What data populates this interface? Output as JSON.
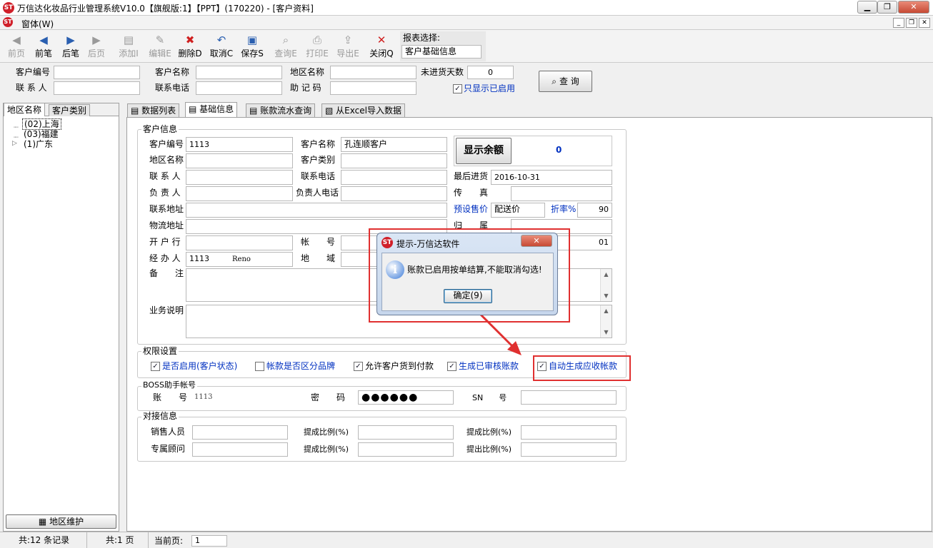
{
  "window": {
    "title": "万信达化妆品行业管理系统V10.0【旗舰版:1】【PPT】(170220) - [客户资料]",
    "logo_text": "ST"
  },
  "menu": {
    "label": "窗体(W)"
  },
  "toolbar": {
    "buttons": [
      {
        "label": "前页",
        "icon": "◀"
      },
      {
        "label": "前笔",
        "icon": "◀"
      },
      {
        "label": "后笔",
        "icon": "▶"
      },
      {
        "label": "后页",
        "icon": "▶"
      },
      {
        "label": "添加I",
        "icon": "▤"
      },
      {
        "label": "编辑E",
        "icon": "✎"
      },
      {
        "label": "删除D",
        "icon": "✖"
      },
      {
        "label": "取消C",
        "icon": "↶"
      },
      {
        "label": "保存S",
        "icon": "▣"
      },
      {
        "label": "查询E",
        "icon": "⌕"
      },
      {
        "label": "打印E",
        "icon": "⎙"
      },
      {
        "label": "导出E",
        "icon": "⇪"
      },
      {
        "label": "关闭Q",
        "icon": "✕"
      }
    ],
    "report_label": "报表选择:",
    "report_value": "客户基础信息"
  },
  "search": {
    "customer_no_label": "客户编号",
    "customer_name_label": "客户名称",
    "region_label": "地区名称",
    "no_ship_days_label": "未进货天数",
    "no_ship_days_value": "0",
    "contact_label": "联 系 人",
    "phone_label": "联系电话",
    "mnemonic_label": "助 记 码",
    "only_enabled_label": "只显示已启用",
    "query_button": "查 询"
  },
  "left_panel": {
    "tabs": [
      "地区名称",
      "客户类别"
    ],
    "tree": [
      "(02)上海",
      "(03)福建",
      "(1)广东"
    ],
    "maintain_button": "地区维护"
  },
  "main_tabs": [
    "数据列表",
    "基础信息",
    "账款流水查询",
    "从Excel导入数据"
  ],
  "customer_info": {
    "title": "客户信息",
    "customer_no_label": "客户编号",
    "customer_no": "1113",
    "customer_name_label": "客户名称",
    "customer_name": "孔连顺客户",
    "show_balance_button": "显示余额",
    "balance": "0",
    "region_label": "地区名称",
    "category_label": "客户类别",
    "contact_label": "联 系 人",
    "phone_label": "联系电话",
    "last_ship_label": "最后进货",
    "last_ship": "2016-10-31",
    "manager_label": "负 责 人",
    "manager_phone_label": "负责人电话",
    "fax_label": "传　　真",
    "address_label": "联系地址",
    "preset_price_label": "预设售价",
    "preset_price": "配送价",
    "discount_label": "折率%",
    "discount": "90",
    "logistics_label": "物流地址",
    "belong_label": "归　　属",
    "bank_label": "开 户 行",
    "account_label": "帐　　号",
    "account_tail": "01",
    "handler_label": "经 办 人",
    "handler_code": "1113",
    "handler_name": "Reno",
    "area_label": "地　　域",
    "remark_label": "备　　注",
    "business_label": "业务说明"
  },
  "permissions": {
    "title": "权限设置",
    "items": [
      "是否启用(客户状态)",
      "帐款是否区分品牌",
      "允许客户货到付款",
      "生成已审核账款",
      "自动生成应收帐款"
    ]
  },
  "boss": {
    "title": "BOSS助手帐号",
    "account_label": "账　　号",
    "account": "1113",
    "password_label": "密　　码",
    "password": "●●●●●●",
    "sn_label": "SN　　号"
  },
  "docking": {
    "title": "对接信息",
    "sales_label": "销售人员",
    "advisor_label": "专属顾问",
    "ratio_labels": [
      "提成比例(%)",
      "提成比例(%)",
      "提成比例(%)",
      "提出比例(%)"
    ]
  },
  "dialog": {
    "title": "提示-万信达软件",
    "message": "账款已启用按单结算,不能取消勾选!",
    "ok_button": "确定(9)",
    "info_icon": "i"
  },
  "status": {
    "records": "共:12 条记录",
    "pages": "共:1 页",
    "current_label": "当前页:",
    "current_value": "1"
  },
  "colors": {
    "highlight": "#e03030",
    "accent_blue": "#0030c0"
  }
}
